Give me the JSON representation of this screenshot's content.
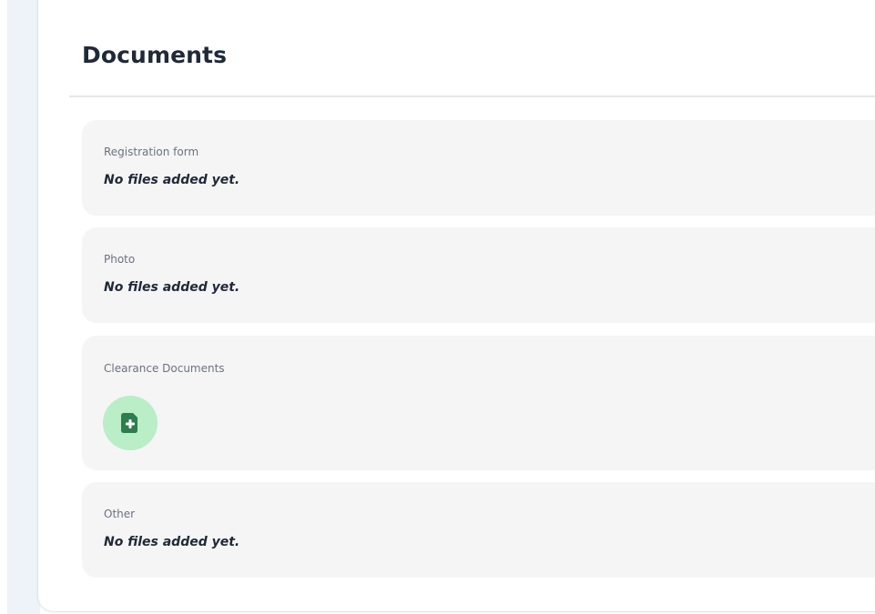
{
  "page": {
    "title": "Documents"
  },
  "sections": [
    {
      "label": "Registration form",
      "status": "No files added yet."
    },
    {
      "label": "Photo",
      "status": "No files added yet."
    },
    {
      "label": "Clearance Documents",
      "add_icon": "file-plus-icon"
    },
    {
      "label": "Other",
      "status": "No files added yet."
    }
  ],
  "colors": {
    "accent_bg": "#b9eec6",
    "accent_icon": "#2e7d4f",
    "section_bg": "#f5f5f6",
    "sidebar_bg": "#eef2f9"
  }
}
